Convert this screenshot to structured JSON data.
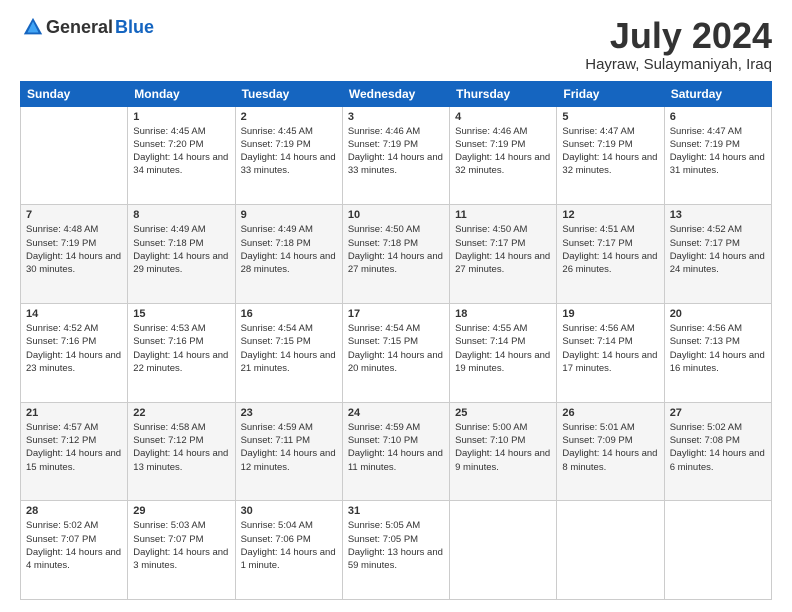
{
  "header": {
    "logo_general": "General",
    "logo_blue": "Blue",
    "title": "July 2024",
    "location": "Hayraw, Sulaymaniyah, Iraq"
  },
  "weekdays": [
    "Sunday",
    "Monday",
    "Tuesday",
    "Wednesday",
    "Thursday",
    "Friday",
    "Saturday"
  ],
  "weeks": [
    [
      {
        "day": "",
        "sunrise": "",
        "sunset": "",
        "daylight": ""
      },
      {
        "day": "1",
        "sunrise": "Sunrise: 4:45 AM",
        "sunset": "Sunset: 7:20 PM",
        "daylight": "Daylight: 14 hours and 34 minutes."
      },
      {
        "day": "2",
        "sunrise": "Sunrise: 4:45 AM",
        "sunset": "Sunset: 7:19 PM",
        "daylight": "Daylight: 14 hours and 33 minutes."
      },
      {
        "day": "3",
        "sunrise": "Sunrise: 4:46 AM",
        "sunset": "Sunset: 7:19 PM",
        "daylight": "Daylight: 14 hours and 33 minutes."
      },
      {
        "day": "4",
        "sunrise": "Sunrise: 4:46 AM",
        "sunset": "Sunset: 7:19 PM",
        "daylight": "Daylight: 14 hours and 32 minutes."
      },
      {
        "day": "5",
        "sunrise": "Sunrise: 4:47 AM",
        "sunset": "Sunset: 7:19 PM",
        "daylight": "Daylight: 14 hours and 32 minutes."
      },
      {
        "day": "6",
        "sunrise": "Sunrise: 4:47 AM",
        "sunset": "Sunset: 7:19 PM",
        "daylight": "Daylight: 14 hours and 31 minutes."
      }
    ],
    [
      {
        "day": "7",
        "sunrise": "Sunrise: 4:48 AM",
        "sunset": "Sunset: 7:19 PM",
        "daylight": "Daylight: 14 hours and 30 minutes."
      },
      {
        "day": "8",
        "sunrise": "Sunrise: 4:49 AM",
        "sunset": "Sunset: 7:18 PM",
        "daylight": "Daylight: 14 hours and 29 minutes."
      },
      {
        "day": "9",
        "sunrise": "Sunrise: 4:49 AM",
        "sunset": "Sunset: 7:18 PM",
        "daylight": "Daylight: 14 hours and 28 minutes."
      },
      {
        "day": "10",
        "sunrise": "Sunrise: 4:50 AM",
        "sunset": "Sunset: 7:18 PM",
        "daylight": "Daylight: 14 hours and 27 minutes."
      },
      {
        "day": "11",
        "sunrise": "Sunrise: 4:50 AM",
        "sunset": "Sunset: 7:17 PM",
        "daylight": "Daylight: 14 hours and 27 minutes."
      },
      {
        "day": "12",
        "sunrise": "Sunrise: 4:51 AM",
        "sunset": "Sunset: 7:17 PM",
        "daylight": "Daylight: 14 hours and 26 minutes."
      },
      {
        "day": "13",
        "sunrise": "Sunrise: 4:52 AM",
        "sunset": "Sunset: 7:17 PM",
        "daylight": "Daylight: 14 hours and 24 minutes."
      }
    ],
    [
      {
        "day": "14",
        "sunrise": "Sunrise: 4:52 AM",
        "sunset": "Sunset: 7:16 PM",
        "daylight": "Daylight: 14 hours and 23 minutes."
      },
      {
        "day": "15",
        "sunrise": "Sunrise: 4:53 AM",
        "sunset": "Sunset: 7:16 PM",
        "daylight": "Daylight: 14 hours and 22 minutes."
      },
      {
        "day": "16",
        "sunrise": "Sunrise: 4:54 AM",
        "sunset": "Sunset: 7:15 PM",
        "daylight": "Daylight: 14 hours and 21 minutes."
      },
      {
        "day": "17",
        "sunrise": "Sunrise: 4:54 AM",
        "sunset": "Sunset: 7:15 PM",
        "daylight": "Daylight: 14 hours and 20 minutes."
      },
      {
        "day": "18",
        "sunrise": "Sunrise: 4:55 AM",
        "sunset": "Sunset: 7:14 PM",
        "daylight": "Daylight: 14 hours and 19 minutes."
      },
      {
        "day": "19",
        "sunrise": "Sunrise: 4:56 AM",
        "sunset": "Sunset: 7:14 PM",
        "daylight": "Daylight: 14 hours and 17 minutes."
      },
      {
        "day": "20",
        "sunrise": "Sunrise: 4:56 AM",
        "sunset": "Sunset: 7:13 PM",
        "daylight": "Daylight: 14 hours and 16 minutes."
      }
    ],
    [
      {
        "day": "21",
        "sunrise": "Sunrise: 4:57 AM",
        "sunset": "Sunset: 7:12 PM",
        "daylight": "Daylight: 14 hours and 15 minutes."
      },
      {
        "day": "22",
        "sunrise": "Sunrise: 4:58 AM",
        "sunset": "Sunset: 7:12 PM",
        "daylight": "Daylight: 14 hours and 13 minutes."
      },
      {
        "day": "23",
        "sunrise": "Sunrise: 4:59 AM",
        "sunset": "Sunset: 7:11 PM",
        "daylight": "Daylight: 14 hours and 12 minutes."
      },
      {
        "day": "24",
        "sunrise": "Sunrise: 4:59 AM",
        "sunset": "Sunset: 7:10 PM",
        "daylight": "Daylight: 14 hours and 11 minutes."
      },
      {
        "day": "25",
        "sunrise": "Sunrise: 5:00 AM",
        "sunset": "Sunset: 7:10 PM",
        "daylight": "Daylight: 14 hours and 9 minutes."
      },
      {
        "day": "26",
        "sunrise": "Sunrise: 5:01 AM",
        "sunset": "Sunset: 7:09 PM",
        "daylight": "Daylight: 14 hours and 8 minutes."
      },
      {
        "day": "27",
        "sunrise": "Sunrise: 5:02 AM",
        "sunset": "Sunset: 7:08 PM",
        "daylight": "Daylight: 14 hours and 6 minutes."
      }
    ],
    [
      {
        "day": "28",
        "sunrise": "Sunrise: 5:02 AM",
        "sunset": "Sunset: 7:07 PM",
        "daylight": "Daylight: 14 hours and 4 minutes."
      },
      {
        "day": "29",
        "sunrise": "Sunrise: 5:03 AM",
        "sunset": "Sunset: 7:07 PM",
        "daylight": "Daylight: 14 hours and 3 minutes."
      },
      {
        "day": "30",
        "sunrise": "Sunrise: 5:04 AM",
        "sunset": "Sunset: 7:06 PM",
        "daylight": "Daylight: 14 hours and 1 minute."
      },
      {
        "day": "31",
        "sunrise": "Sunrise: 5:05 AM",
        "sunset": "Sunset: 7:05 PM",
        "daylight": "Daylight: 13 hours and 59 minutes."
      },
      {
        "day": "",
        "sunrise": "",
        "sunset": "",
        "daylight": ""
      },
      {
        "day": "",
        "sunrise": "",
        "sunset": "",
        "daylight": ""
      },
      {
        "day": "",
        "sunrise": "",
        "sunset": "",
        "daylight": ""
      }
    ]
  ]
}
